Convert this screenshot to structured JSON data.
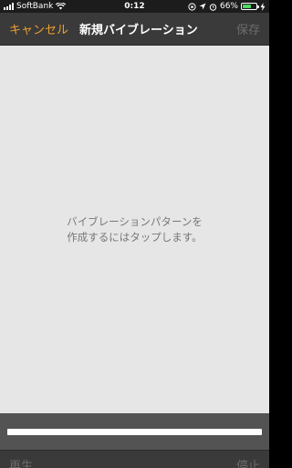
{
  "status_bar": {
    "carrier": "SoftBank",
    "time": "0:12",
    "battery_percent": "66%",
    "battery_level": 0.66
  },
  "nav": {
    "cancel_label": "キャンセル",
    "title": "新規バイブレーション",
    "save_label": "保存"
  },
  "main": {
    "instruction": "バイブレーションパターンを\n作成するにはタップします。"
  },
  "bottom": {
    "left_label": "再生",
    "right_label": "停止"
  },
  "colors": {
    "accent": "#f0a030",
    "disabled": "#6c6c6c",
    "battery": "#4cd964"
  }
}
